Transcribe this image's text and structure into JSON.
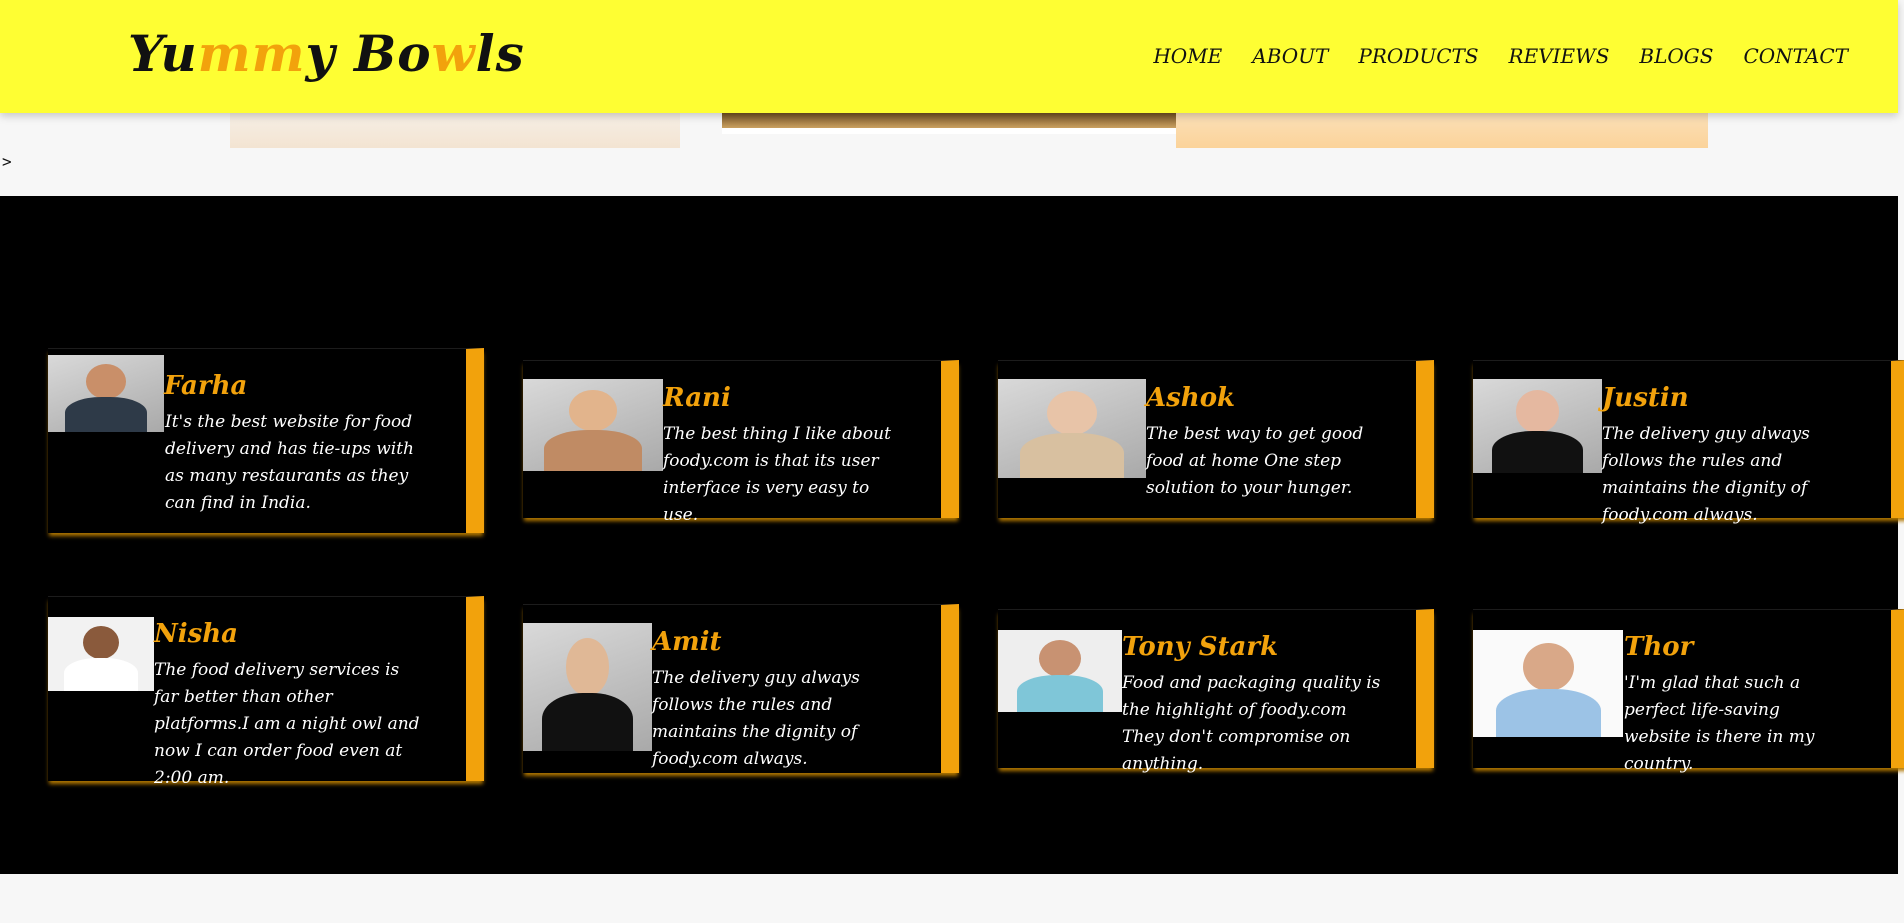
{
  "header": {
    "logo_parts": [
      "Yu",
      "mm",
      "y Bo",
      "w",
      "ls"
    ],
    "nav": [
      "HOME",
      "ABOUT",
      "PRODUCTS",
      "REVIEWS",
      "BLOGS",
      "CONTACT"
    ]
  },
  "stray_text": ">",
  "colors": {
    "header": "#fefe33",
    "accent": "#f2a20c",
    "section": "#000000"
  },
  "reviews": [
    {
      "name": "Farha",
      "quote": "It's the best website for food delivery and has tie-ups with as many restaurants as they can find in India.",
      "icon": "avatar-photo"
    },
    {
      "name": "Rani",
      "quote": "The best thing I like about foody.com is that its user interface is very easy to use.",
      "icon": "avatar-photo"
    },
    {
      "name": "Ashok",
      "quote": "The best way to get good food at home One step solution to your hunger.",
      "icon": "avatar-photo"
    },
    {
      "name": "Justin",
      "quote": "The delivery guy always follows the rules and maintains the dignity of foody.com always.",
      "icon": "avatar-photo"
    },
    {
      "name": "Nisha",
      "quote": "The food delivery services is far better than other platforms.I am a night owl and now I can order food even at 2:00 am.",
      "icon": "avatar-photo"
    },
    {
      "name": "Amit",
      "quote": "The delivery guy always follows the rules and maintains the dignity of foody.com always.",
      "icon": "avatar-photo"
    },
    {
      "name": "Tony Stark",
      "quote": "Food and packaging quality is the highlight of foody.com They don't compromise on anything.",
      "icon": "avatar-photo"
    },
    {
      "name": "Thor",
      "quote": "'I'm glad that such a perfect life-saving website is there in my country.",
      "icon": "avatar-photo"
    }
  ]
}
